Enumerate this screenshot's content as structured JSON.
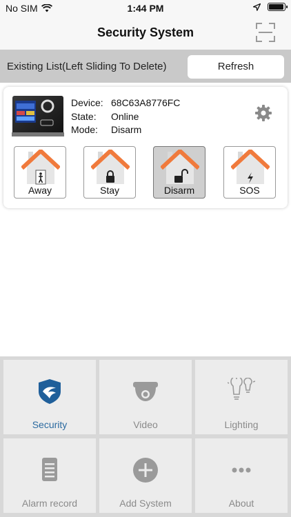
{
  "status_bar": {
    "carrier": "No SIM",
    "time": "1:44 PM",
    "battery_level": 0.95
  },
  "nav": {
    "title": "Security System"
  },
  "list_header": {
    "text": "Existing List(Left Sliding To Delete)",
    "refresh_label": "Refresh"
  },
  "device": {
    "device_key": "Device:",
    "device_value": "68C63A8776FC",
    "state_key": "State:",
    "state_value": "Online",
    "mode_key": "Mode:",
    "mode_value": "Disarm"
  },
  "modes": [
    {
      "label": "Away",
      "icon": "away-house-icon",
      "active": false
    },
    {
      "label": "Stay",
      "icon": "stay-house-icon",
      "active": false
    },
    {
      "label": "Disarm",
      "icon": "disarm-house-icon",
      "active": true
    },
    {
      "label": "SOS",
      "icon": "sos-house-icon",
      "active": false
    }
  ],
  "menu": [
    {
      "label": "Security",
      "icon": "security-shield-icon",
      "active": true
    },
    {
      "label": "Video",
      "icon": "camera-icon",
      "active": false
    },
    {
      "label": "Lighting",
      "icon": "light-bulb-icon",
      "active": false
    },
    {
      "label": "Alarm record",
      "icon": "clipboard-icon",
      "active": false
    },
    {
      "label": "Add System",
      "icon": "add-circle-icon",
      "active": false
    },
    {
      "label": "About",
      "icon": "more-dots-icon",
      "active": false
    }
  ],
  "colors": {
    "accent": "#2b6aa0",
    "roof": "#f07a3c",
    "header_bg": "#c9c9c9",
    "grid_bg": "#ececec",
    "inactive_icon": "#9a9a9a"
  }
}
